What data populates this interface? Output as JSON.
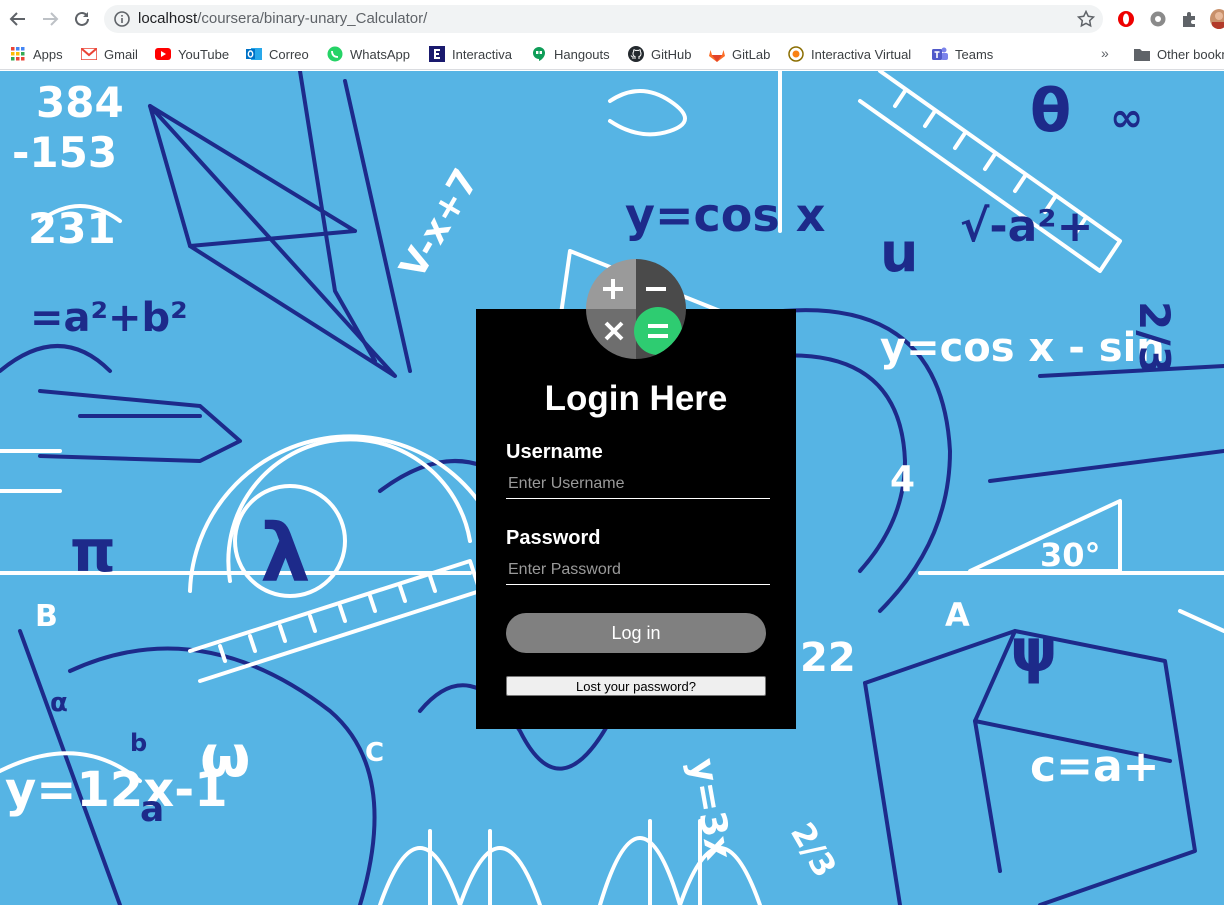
{
  "browser": {
    "url_host": "localhost",
    "url_path": "/coursera/binary-unary_Calculator/"
  },
  "bookmarks": {
    "items": [
      {
        "label": "Apps",
        "icon": "apps-grid-icon",
        "color": "#4285f4"
      },
      {
        "label": "Gmail",
        "icon": "gmail-icon",
        "color": "#ea4335"
      },
      {
        "label": "YouTube",
        "icon": "youtube-icon",
        "color": "#ff0000"
      },
      {
        "label": "Correo",
        "icon": "outlook-icon",
        "color": "#0072c6"
      },
      {
        "label": "WhatsApp",
        "icon": "whatsapp-icon",
        "color": "#25d366"
      },
      {
        "label": "Interactiva",
        "icon": "interactiva-icon",
        "color": "#1a1a6e"
      },
      {
        "label": "Hangouts",
        "icon": "hangouts-icon",
        "color": "#0f9d58"
      },
      {
        "label": "GitHub",
        "icon": "github-icon",
        "color": "#24292e"
      },
      {
        "label": "GitLab",
        "icon": "gitlab-icon",
        "color": "#e24329"
      },
      {
        "label": "Interactiva Virtual",
        "icon": "moodle-icon",
        "color": "#f98012"
      },
      {
        "label": "Teams",
        "icon": "teams-icon",
        "color": "#5059c9"
      }
    ],
    "more": "»",
    "other": "Other bookmarks"
  },
  "login": {
    "title": "Login Here",
    "username_label": "Username",
    "username_placeholder": "Enter Username",
    "password_label": "Password",
    "password_placeholder": "Enter Password",
    "submit_label": "Log in",
    "lost_password_label": "Lost your password?"
  },
  "colors": {
    "page_background": "#56b4e4",
    "doodle_navy": "#1d2a8a",
    "doodle_white": "#ffffff",
    "box_background": "#000000",
    "button_gray": "#808080",
    "equals_green": "#2ecc71"
  }
}
